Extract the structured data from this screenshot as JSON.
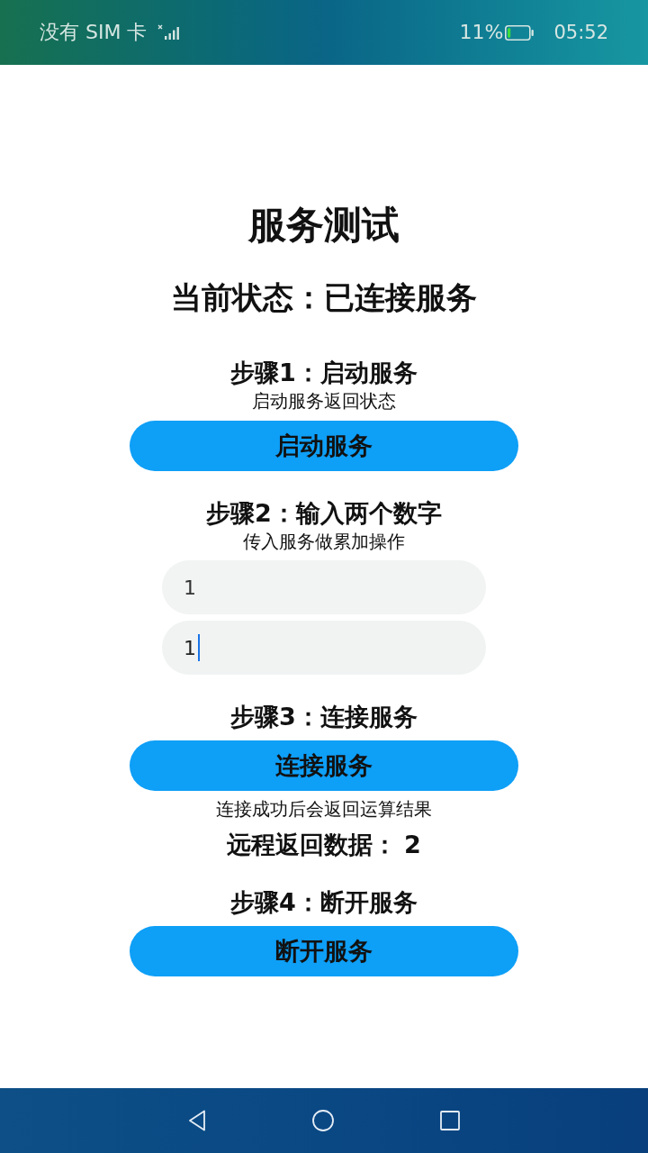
{
  "status_bar": {
    "carrier": "没有 SIM 卡",
    "battery": "11%",
    "time": "05:52"
  },
  "page": {
    "title": "服务测试",
    "status": "当前状态：已连接服务"
  },
  "steps": [
    {
      "heading": "步骤1：启动服务",
      "description": "启动服务返回状态",
      "button": "启动服务"
    },
    {
      "heading": "步骤2：输入两个数字",
      "description": "传入服务做累加操作",
      "inputs": [
        {
          "value": "1",
          "focused": false
        },
        {
          "value": "1",
          "focused": true
        }
      ]
    },
    {
      "heading": "步骤3：连接服务",
      "button": "连接服务",
      "note": "连接成功后会返回运算结果",
      "result": {
        "label": "远程返回数据：",
        "value": "2"
      }
    },
    {
      "heading": "步骤4：断开服务",
      "button": "断开服务"
    }
  ]
}
